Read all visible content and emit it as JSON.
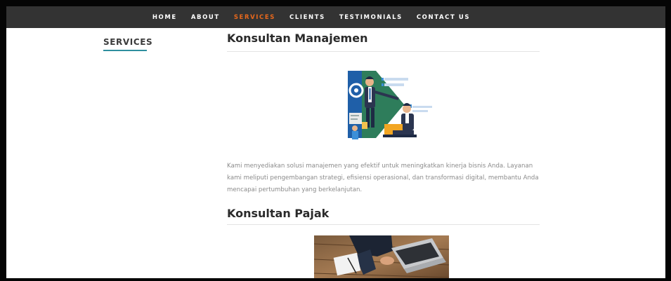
{
  "nav": {
    "items": [
      {
        "label": "HOME"
      },
      {
        "label": "ABOUT"
      },
      {
        "label": "SERVICES"
      },
      {
        "label": "CLIENTS"
      },
      {
        "label": "TESTIMONIALS"
      },
      {
        "label": "CONTACT US"
      }
    ],
    "active_index": 2
  },
  "sidebar": {
    "title": "SERVICES"
  },
  "sections": [
    {
      "title": "Konsultan Manajemen",
      "image_icon": "management-consulting-illustration",
      "description": "Kami menyediakan solusi manajemen yang efektif untuk meningkatkan kinerja bisnis Anda. Layanan kami meliputi pengembangan strategi, efisiensi operasional, dan transformasi digital, membantu Anda mencapai pertumbuhan yang berkelanjutan."
    },
    {
      "title": "Konsultan Pajak",
      "image_icon": "laptop-desk-photo"
    }
  ],
  "colors": {
    "frame": "#050505",
    "navbar": "#333333",
    "nav_text": "#ffffff",
    "nav_active": "#e8681c",
    "accent_underline": "#2f8f9f",
    "body_text": "#8a8a8a",
    "heading_text": "#2a2a2a"
  }
}
